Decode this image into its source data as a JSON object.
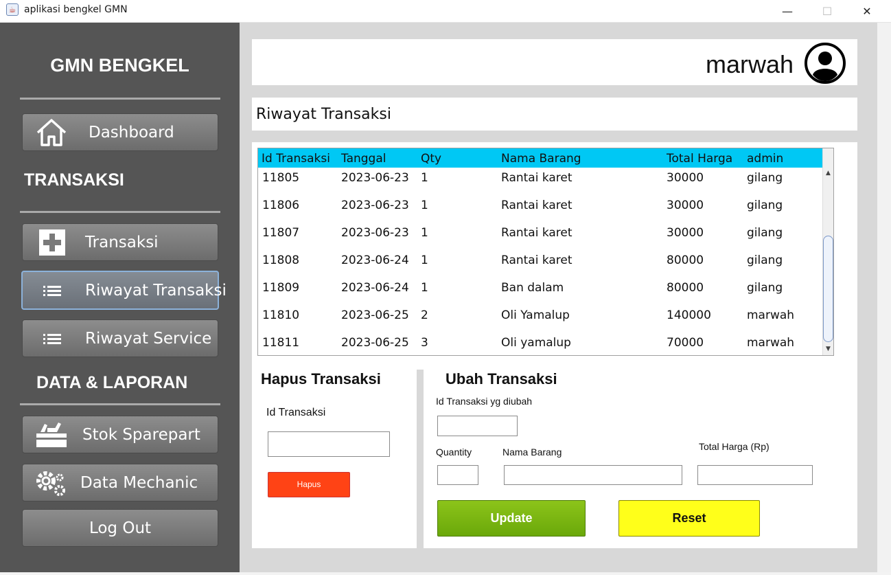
{
  "window": {
    "title": "aplikasi bengkel GMN",
    "minimize": "—",
    "maximize": "☐",
    "close": "✕"
  },
  "sidebar": {
    "brand": "GMN BENGKEL",
    "dashboard": "Dashboard",
    "section_transaksi": "TRANSAKSI",
    "transaksi": "Transaksi",
    "riwayat_transaksi": "Riwayat Transaksi",
    "riwayat_service": "Riwayat Service",
    "section_data": "DATA & LAPORAN",
    "stok_sparepart": "Stok Sparepart",
    "data_mechanic": "Data Mechanic",
    "logout": "Log Out"
  },
  "header": {
    "username": "marwah"
  },
  "page": {
    "title": "Riwayat Transaksi"
  },
  "table": {
    "columns": [
      "Id Transaksi",
      "Tanggal",
      "Qty",
      "Nama Barang",
      "Total Harga",
      "admin"
    ],
    "rows": [
      [
        "11805",
        "2023-06-23",
        "1",
        "Rantai karet",
        "30000",
        "gilang"
      ],
      [
        "11806",
        "2023-06-23",
        "1",
        "Rantai karet",
        "30000",
        "gilang"
      ],
      [
        "11807",
        "2023-06-23",
        "1",
        "Rantai karet",
        "30000",
        "gilang"
      ],
      [
        "11808",
        "2023-06-24",
        "1",
        "Rantai karet",
        "80000",
        "gilang"
      ],
      [
        "11809",
        "2023-06-24",
        "1",
        "Ban dalam",
        "80000",
        "gilang"
      ],
      [
        "11810",
        "2023-06-25",
        "2",
        "Oli Yamalup",
        "140000",
        "marwah"
      ],
      [
        "11811",
        "2023-06-25",
        "3",
        "Oli yamalup",
        "70000",
        "marwah"
      ]
    ]
  },
  "hapus": {
    "title": "Hapus Transaksi",
    "id_label": "Id Transaksi",
    "id_value": "",
    "button": "Hapus"
  },
  "ubah": {
    "title": "Ubah Transaksi",
    "id_label": "Id Transaksi yg diubah",
    "qty_label": "Quantity",
    "nama_label": "Nama Barang",
    "total_label": "Total Harga (Rp)",
    "update_button": "Update",
    "reset_button": "Reset"
  },
  "colors": {
    "sidebar": "#555555",
    "table_header": "#00c8f4",
    "hapus": "#ff4315",
    "update": "#7ab812",
    "reset": "#ffff1a"
  }
}
